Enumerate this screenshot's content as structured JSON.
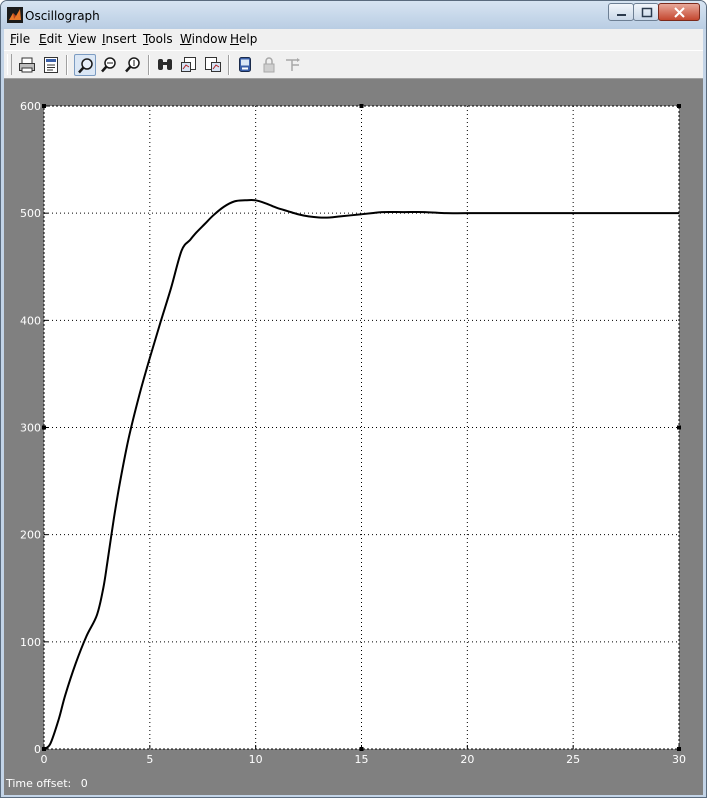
{
  "window": {
    "title": "Oscillograph",
    "controls": {
      "minimize": "minimize",
      "maximize": "maximize",
      "close": "close"
    }
  },
  "menubar": {
    "items": [
      {
        "label": "File",
        "accel": "F"
      },
      {
        "label": "Edit",
        "accel": "E"
      },
      {
        "label": "View",
        "accel": "V"
      },
      {
        "label": "Insert",
        "accel": "I"
      },
      {
        "label": "Tools",
        "accel": "T"
      },
      {
        "label": "Window",
        "accel": "W"
      },
      {
        "label": "Help",
        "accel": "H"
      }
    ]
  },
  "toolbar": {
    "buttons": [
      {
        "icon": "print-icon"
      },
      {
        "icon": "parameters-icon"
      },
      {
        "icon": "zoom-icon",
        "pressed": true
      },
      {
        "icon": "zoom-x-icon"
      },
      {
        "icon": "zoom-y-icon"
      },
      {
        "icon": "autoscale-icon"
      },
      {
        "icon": "save-axes-icon"
      },
      {
        "icon": "restore-axes-icon"
      },
      {
        "icon": "floating-scope-icon"
      },
      {
        "icon": "lock-axes-icon",
        "disabled": true
      },
      {
        "icon": "signal-selector-icon",
        "disabled": true
      }
    ]
  },
  "status": {
    "label": "Time offset:",
    "value": "0"
  },
  "chart_data": {
    "type": "line",
    "xlim": [
      0,
      30
    ],
    "ylim": [
      0,
      600
    ],
    "xticks": [
      "0",
      "5",
      "10",
      "15",
      "20",
      "25",
      "30"
    ],
    "yticks": [
      "0",
      "100",
      "200",
      "300",
      "400",
      "500",
      "600"
    ],
    "grid": true,
    "series": [
      {
        "color": "#000000",
        "x": [
          0,
          0.3,
          0.7,
          1.0,
          1.5,
          2.0,
          2.5,
          2.8,
          3.0,
          3.3,
          3.6,
          4.0,
          4.5,
          5.0,
          5.5,
          6.0,
          6.5,
          6.9,
          7.2,
          7.6,
          8.0,
          8.5,
          9.0,
          9.5,
          10.0,
          10.5,
          11.0,
          11.5,
          12.0,
          12.5,
          13.0,
          13.5,
          14.0,
          14.5,
          15.0,
          15.5,
          16.0,
          17.0,
          18.0,
          19.0,
          20.0,
          22.0,
          25.0,
          28.0,
          30.0
        ],
        "y": [
          0,
          5,
          28,
          50,
          80,
          105,
          125,
          150,
          175,
          215,
          250,
          290,
          330,
          365,
          398,
          430,
          465,
          475,
          482,
          490,
          498,
          506,
          511,
          512,
          512,
          509,
          505,
          502,
          499,
          497,
          496,
          496,
          497,
          498,
          499,
          500,
          501,
          501,
          501,
          500,
          500,
          500,
          500,
          500,
          500
        ]
      }
    ]
  }
}
